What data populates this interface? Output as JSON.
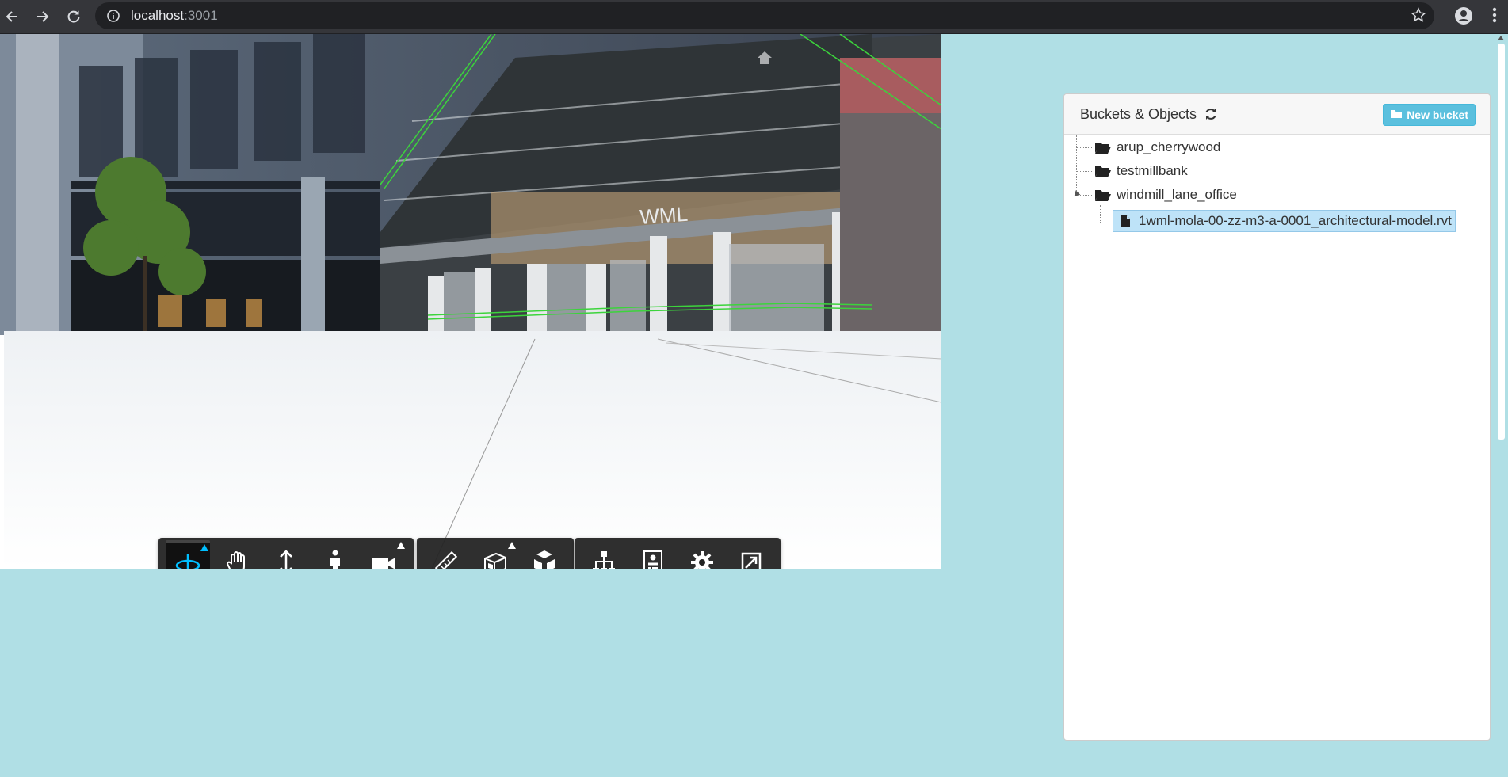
{
  "browser": {
    "url_host": "localhost",
    "url_port": ":3001",
    "icons": [
      "back-arrow-icon",
      "forward-arrow-icon",
      "reload-icon",
      "info-icon",
      "star-icon",
      "profile-icon",
      "more-menu-icon"
    ]
  },
  "viewer": {
    "toolbar": {
      "navigation": [
        "orbit-icon",
        "pan-icon",
        "zoom-icon",
        "first-person-icon",
        "camera-icon"
      ],
      "modeling": [
        "measure-icon",
        "section-icon",
        "explode-icon"
      ],
      "settings": [
        "model-browser-icon",
        "properties-icon",
        "settings-icon",
        "fullscreen-icon"
      ]
    },
    "model_sign": "WML"
  },
  "panel": {
    "title": "Buckets & Objects",
    "new_bucket_label": "New bucket",
    "buckets": [
      {
        "name": "arup_cherrywood"
      },
      {
        "name": "testmillbank"
      },
      {
        "name": "windmill_lane_office"
      }
    ],
    "objects": [
      {
        "name": "1wml-mola-00-zz-m3-a-0001_architectural-model.rvt"
      }
    ]
  },
  "colors": {
    "page_bg": "#b0dfe5",
    "accent": "#5bc0de",
    "selected_bg": "#bee3f8",
    "toolbar_active": "#00bfff"
  }
}
